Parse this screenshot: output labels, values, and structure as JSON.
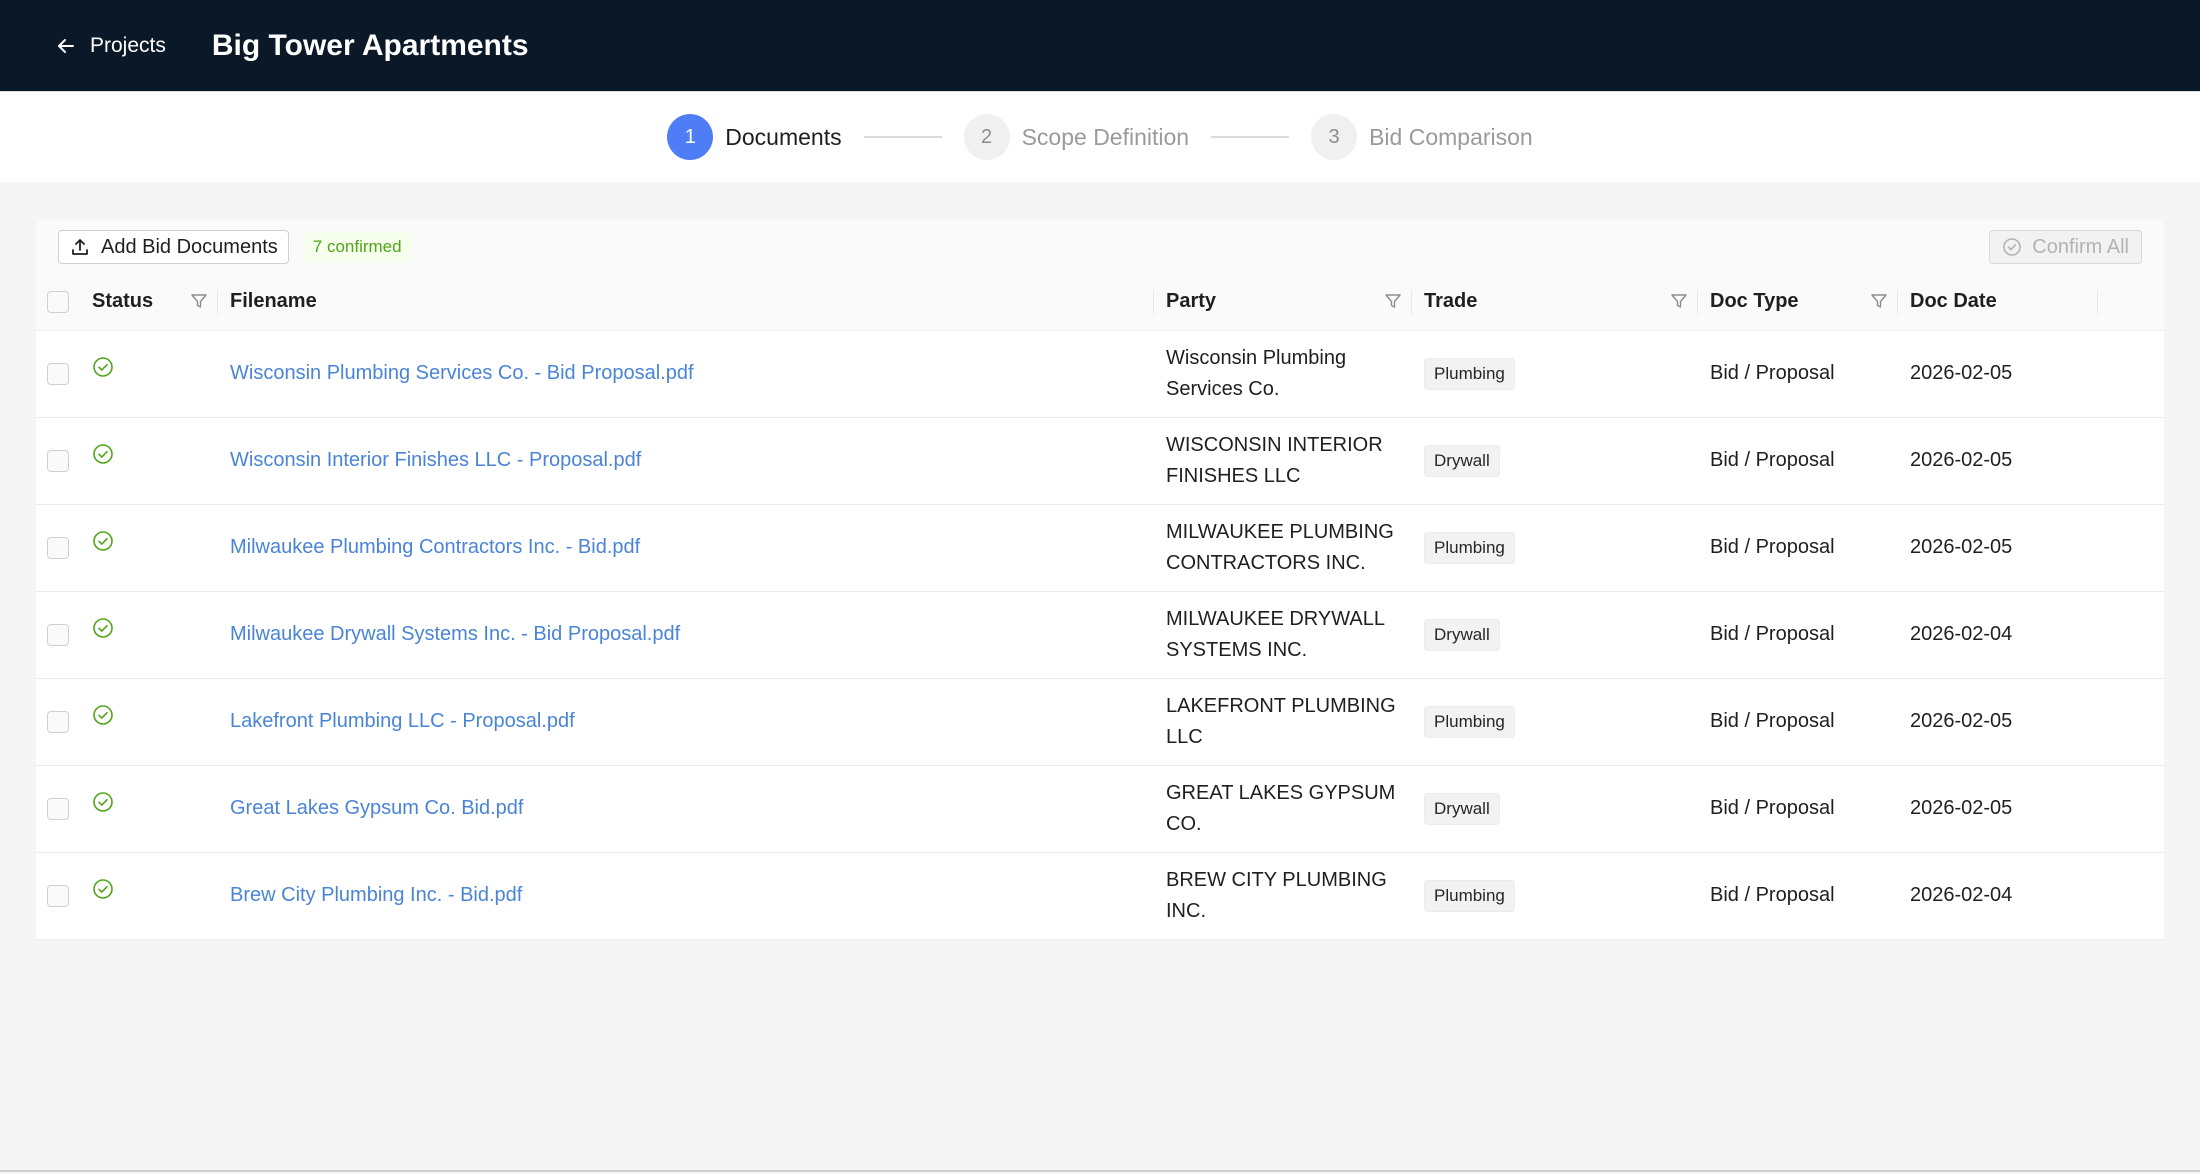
{
  "header": {
    "back_label": "Projects",
    "project_title": "Big Tower Apartments"
  },
  "steps": [
    {
      "number": "1",
      "label": "Documents",
      "active": true
    },
    {
      "number": "2",
      "label": "Scope Definition",
      "active": false
    },
    {
      "number": "3",
      "label": "Bid Comparison",
      "active": false
    }
  ],
  "toolbar": {
    "add_button_label": "Add Bid Documents",
    "confirmed_badge": "7 confirmed",
    "confirm_all_label": "Confirm All"
  },
  "table": {
    "columns": {
      "status": "Status",
      "filename": "Filename",
      "party": "Party",
      "trade": "Trade",
      "doc_type": "Doc Type",
      "doc_date": "Doc Date"
    },
    "rows": [
      {
        "status": "confirmed",
        "filename": "Wisconsin Plumbing Services Co. - Bid Proposal.pdf",
        "party": "Wisconsin Plumbing Services Co.",
        "trade": "Plumbing",
        "doc_type": "Bid / Proposal",
        "doc_date": "2026-02-05"
      },
      {
        "status": "confirmed",
        "filename": "Wisconsin Interior Finishes LLC - Proposal.pdf",
        "party": "WISCONSIN INTERIOR FINISHES LLC",
        "trade": "Drywall",
        "doc_type": "Bid / Proposal",
        "doc_date": "2026-02-05"
      },
      {
        "status": "confirmed",
        "filename": "Milwaukee Plumbing Contractors Inc. - Bid.pdf",
        "party": "MILWAUKEE PLUMBING CONTRACTORS INC.",
        "trade": "Plumbing",
        "doc_type": "Bid / Proposal",
        "doc_date": "2026-02-05"
      },
      {
        "status": "confirmed",
        "filename": "Milwaukee Drywall Systems Inc. - Bid Proposal.pdf",
        "party": "MILWAUKEE DRYWALL SYSTEMS INC.",
        "trade": "Drywall",
        "doc_type": "Bid / Proposal",
        "doc_date": "2026-02-04"
      },
      {
        "status": "confirmed",
        "filename": "Lakefront Plumbing LLC - Proposal.pdf",
        "party": "LAKEFRONT PLUMBING LLC",
        "trade": "Plumbing",
        "doc_type": "Bid / Proposal",
        "doc_date": "2026-02-05"
      },
      {
        "status": "confirmed",
        "filename": "Great Lakes Gypsum Co. Bid.pdf",
        "party": "GREAT LAKES GYPSUM CO.",
        "trade": "Drywall",
        "doc_type": "Bid / Proposal",
        "doc_date": "2026-02-05"
      },
      {
        "status": "confirmed",
        "filename": "Brew City Plumbing Inc. - Bid.pdf",
        "party": "BREW CITY PLUMBING INC.",
        "trade": "Plumbing",
        "doc_type": "Bid / Proposal",
        "doc_date": "2026-02-04"
      }
    ]
  },
  "colors": {
    "header_bg": "#0b1828",
    "step_active": "#4f7df5",
    "link": "#4a84d6",
    "confirmed_green": "#52a41a"
  }
}
